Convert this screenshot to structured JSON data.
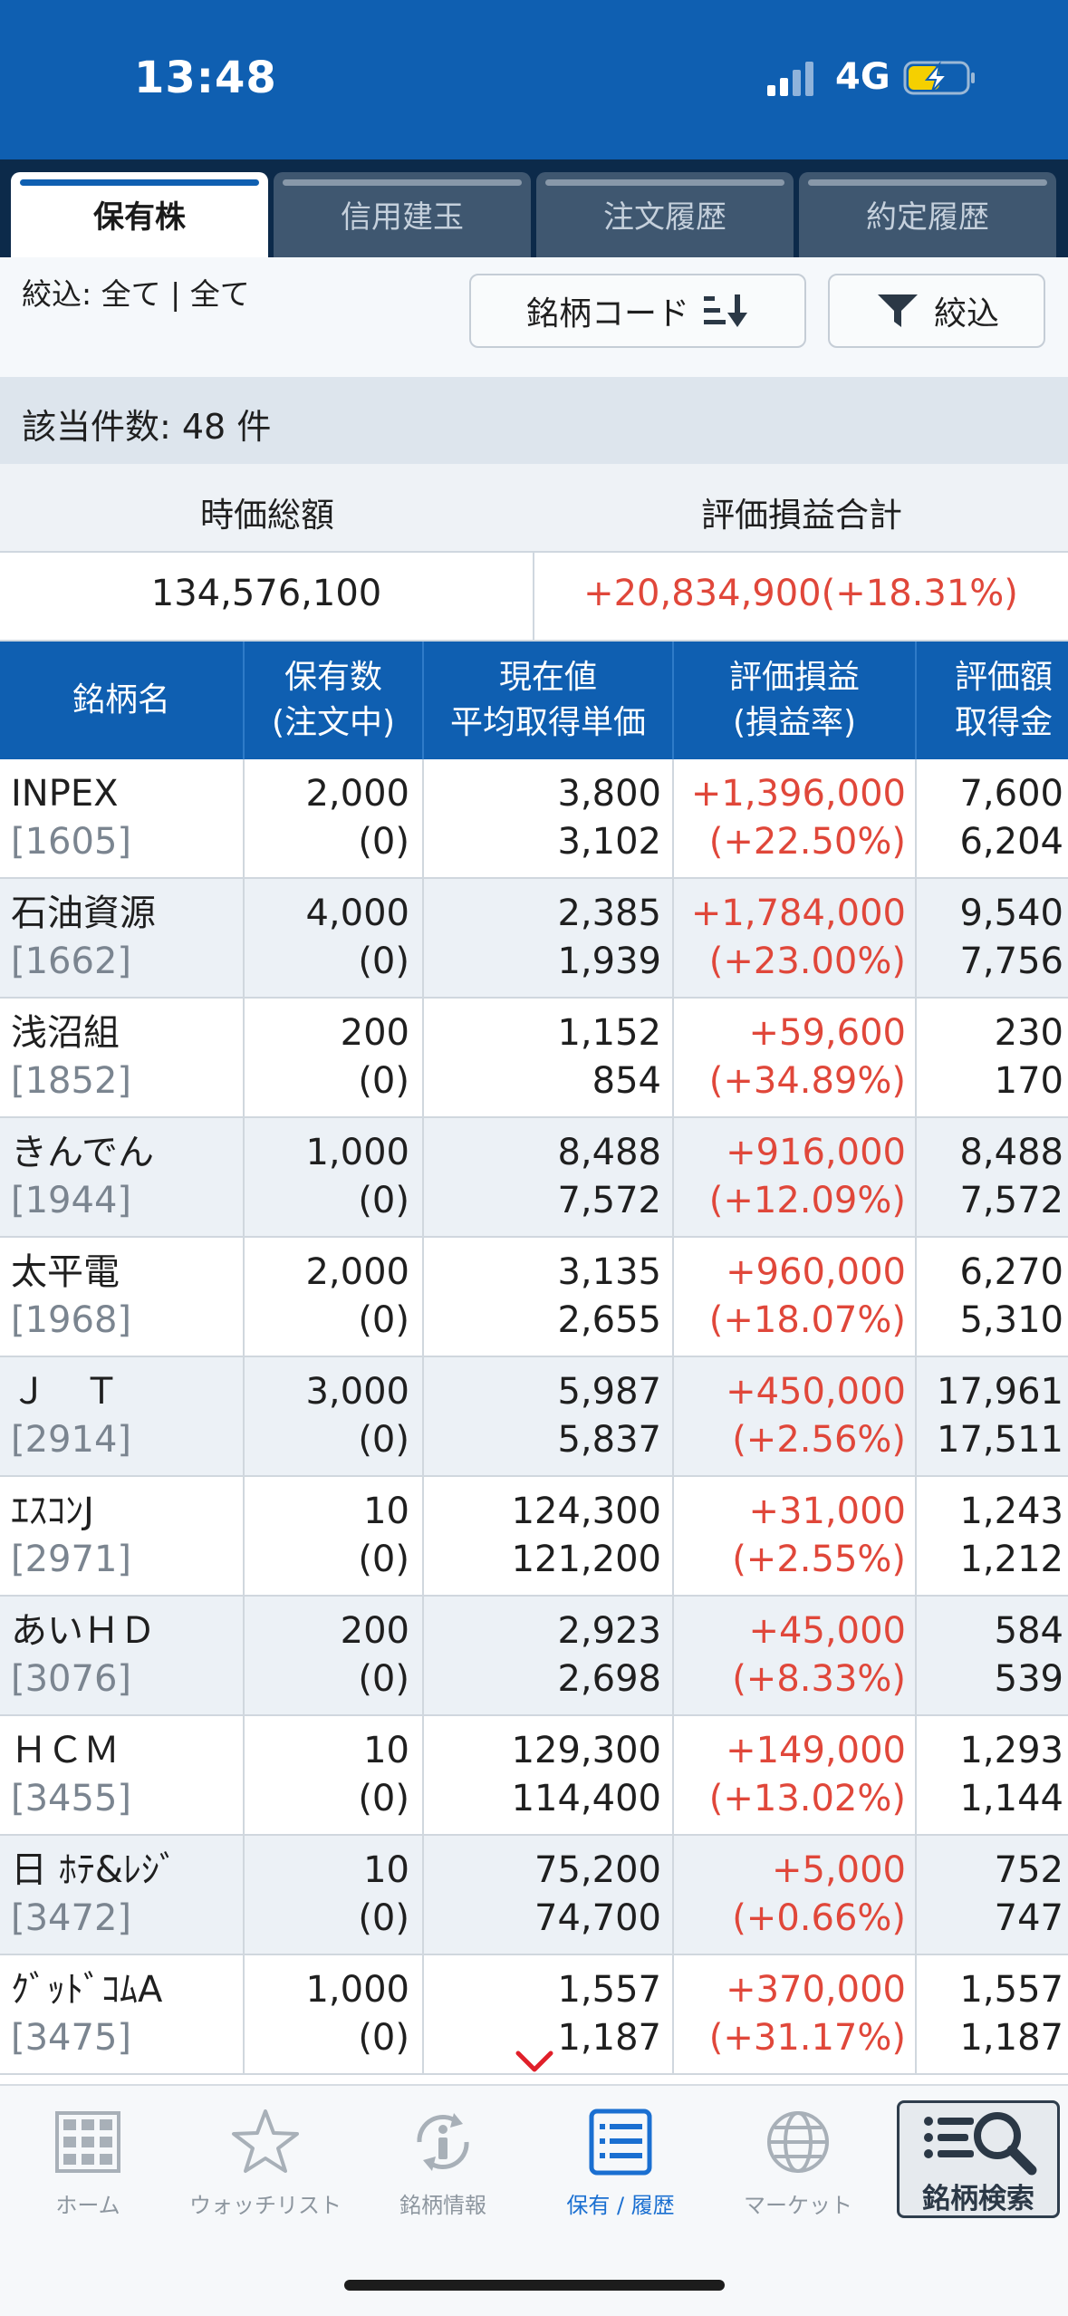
{
  "status_bar": {
    "time": "13:48",
    "network": "4G"
  },
  "tabs": [
    "保有株",
    "信用建玉",
    "注文履歴",
    "約定履歴"
  ],
  "filter": {
    "label": "絞込:  全て | 全て",
    "sort_button": "銘柄コード",
    "filter_button": "絞込"
  },
  "count_text": "該当件数: 48 件",
  "summary": {
    "market_value_label": "時価総額",
    "pnl_label": "評価損益合計",
    "market_value": "134,576,100",
    "pnl_value": "+20,834,900(+18.31%)"
  },
  "table": {
    "headers": [
      {
        "l1": "銘柄名",
        "l2": ""
      },
      {
        "l1": "保有数",
        "l2": "(注文中)"
      },
      {
        "l1": "現在値",
        "l2": "平均取得単価"
      },
      {
        "l1": "評価損益",
        "l2": "(損益率)"
      },
      {
        "l1": "評価額",
        "l2": "取得金"
      }
    ],
    "rows": [
      {
        "name": "INPEX",
        "code": "[1605]",
        "qty": "2,000",
        "pending": "(0)",
        "price": "3,800",
        "avg": "3,102",
        "pnl": "+1,396,000",
        "rate": "(+22.50%)",
        "val": "7,600",
        "cost": "6,204"
      },
      {
        "name": "石油資源",
        "code": "[1662]",
        "qty": "4,000",
        "pending": "(0)",
        "price": "2,385",
        "avg": "1,939",
        "pnl": "+1,784,000",
        "rate": "(+23.00%)",
        "val": "9,540",
        "cost": "7,756"
      },
      {
        "name": "浅沼組",
        "code": "[1852]",
        "qty": "200",
        "pending": "(0)",
        "price": "1,152",
        "avg": "854",
        "pnl": "+59,600",
        "rate": "(+34.89%)",
        "val": "230",
        "cost": "170"
      },
      {
        "name": "きんでん",
        "code": "[1944]",
        "qty": "1,000",
        "pending": "(0)",
        "price": "8,488",
        "avg": "7,572",
        "pnl": "+916,000",
        "rate": "(+12.09%)",
        "val": "8,488",
        "cost": "7,572"
      },
      {
        "name": "太平電",
        "code": "[1968]",
        "qty": "2,000",
        "pending": "(0)",
        "price": "3,135",
        "avg": "2,655",
        "pnl": "+960,000",
        "rate": "(+18.07%)",
        "val": "6,270",
        "cost": "5,310"
      },
      {
        "name": "Ｊ　Ｔ",
        "code": "[2914]",
        "qty": "3,000",
        "pending": "(0)",
        "price": "5,987",
        "avg": "5,837",
        "pnl": "+450,000",
        "rate": "(+2.56%)",
        "val": "17,961",
        "cost": "17,511"
      },
      {
        "name": "ｴｽｺﾝJ",
        "code": "[2971]",
        "qty": "10",
        "pending": "(0)",
        "price": "124,300",
        "avg": "121,200",
        "pnl": "+31,000",
        "rate": "(+2.55%)",
        "val": "1,243",
        "cost": "1,212"
      },
      {
        "name": "あいＨＤ",
        "code": "[3076]",
        "qty": "200",
        "pending": "(0)",
        "price": "2,923",
        "avg": "2,698",
        "pnl": "+45,000",
        "rate": "(+8.33%)",
        "val": "584",
        "cost": "539"
      },
      {
        "name": "ＨＣＭ",
        "code": "[3455]",
        "qty": "10",
        "pending": "(0)",
        "price": "129,300",
        "avg": "114,400",
        "pnl": "+149,000",
        "rate": "(+13.02%)",
        "val": "1,293",
        "cost": "1,144"
      },
      {
        "name": "日 ﾎﾃ&ﾚｼﾞ",
        "code": "[3472]",
        "qty": "10",
        "pending": "(0)",
        "price": "75,200",
        "avg": "74,700",
        "pnl": "+5,000",
        "rate": "(+0.66%)",
        "val": "752",
        "cost": "747"
      },
      {
        "name": "ｸﾞｯﾄﾞｺﾑA",
        "code": "[3475]",
        "qty": "1,000",
        "pending": "(0)",
        "price": "1,557",
        "avg": "1,187",
        "pnl": "+370,000",
        "rate": "(+31.17%)",
        "val": "1,557",
        "cost": "1,187"
      }
    ]
  },
  "bottom_nav": [
    {
      "label": "ホーム",
      "icon": "grid-icon"
    },
    {
      "label": "ウォッチリスト",
      "icon": "star-icon"
    },
    {
      "label": "銘柄情報",
      "icon": "info-refresh-icon"
    },
    {
      "label": "保有 / 履歴",
      "icon": "list-icon"
    },
    {
      "label": "マーケット",
      "icon": "globe-icon"
    }
  ],
  "search_button": "銘柄検索",
  "colors": {
    "brand_blue": "#0f5fb1",
    "gain_red": "#e0473a",
    "tab_dark": "#0c2a4a"
  }
}
